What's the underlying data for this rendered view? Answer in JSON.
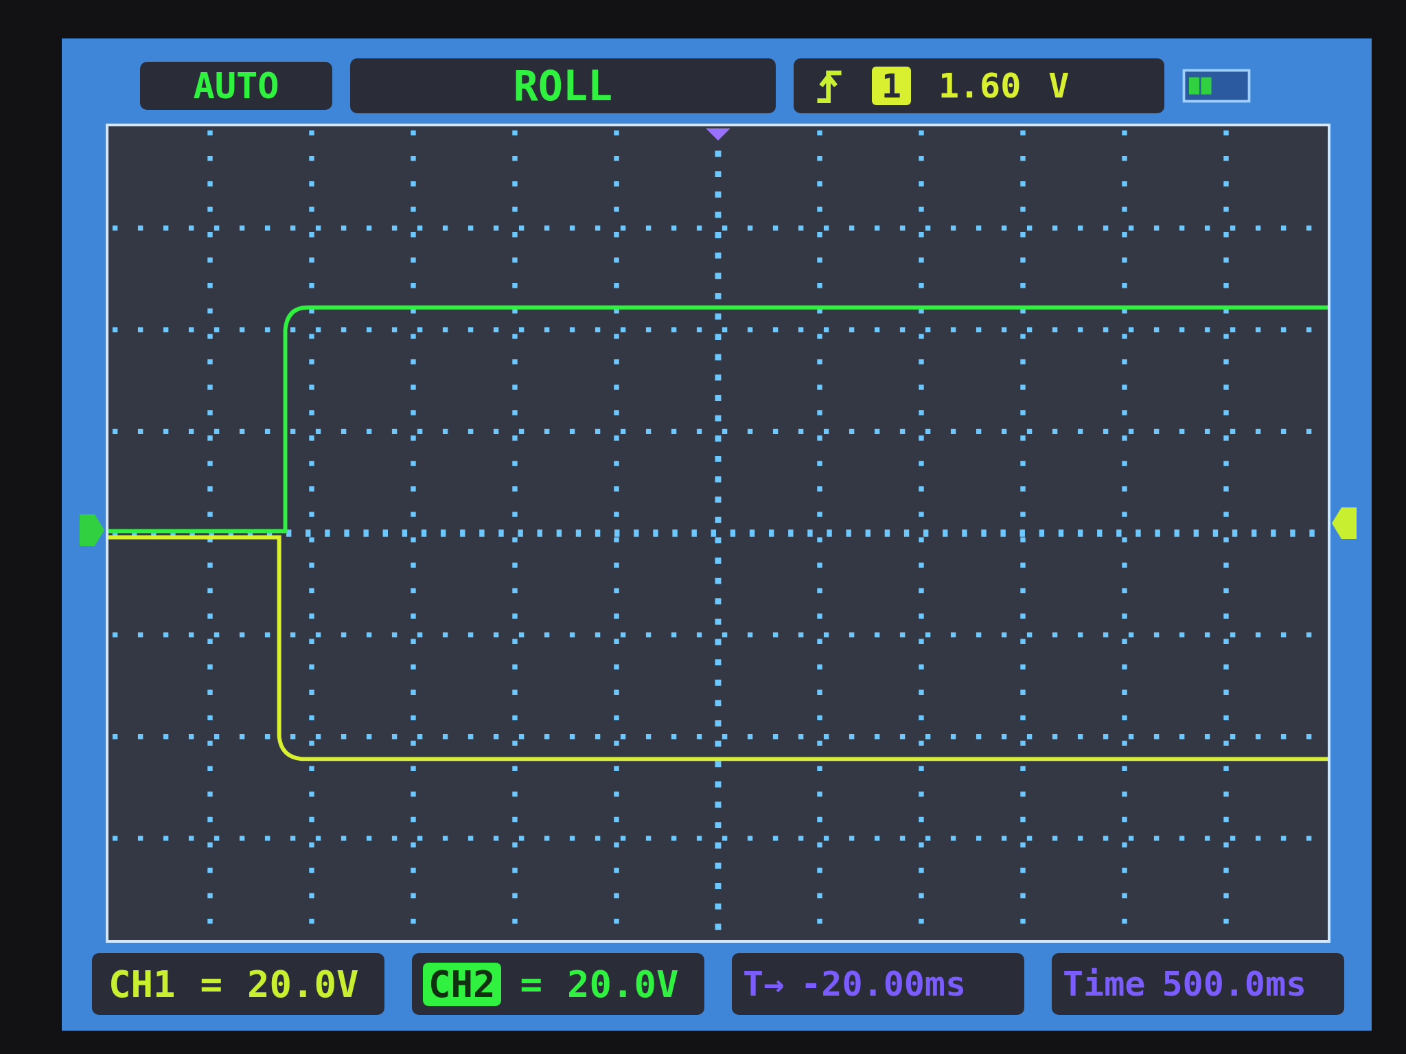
{
  "header": {
    "mode": "AUTO",
    "status": "ROLL",
    "trigger": {
      "channel": "1",
      "level": "1.60",
      "unit": "V"
    }
  },
  "channels": [
    {
      "label": "CH1",
      "coupling": "=",
      "scale": "20.0V",
      "selected": false,
      "color": "#c8f030"
    },
    {
      "label": "CH2",
      "coupling": "=",
      "scale": "20.0V",
      "selected": true,
      "color": "#30f040"
    }
  ],
  "trigger_offset": {
    "label": "T→",
    "value": "-20.00ms"
  },
  "timebase": {
    "label": "Time",
    "value": "500.0ms"
  }
}
